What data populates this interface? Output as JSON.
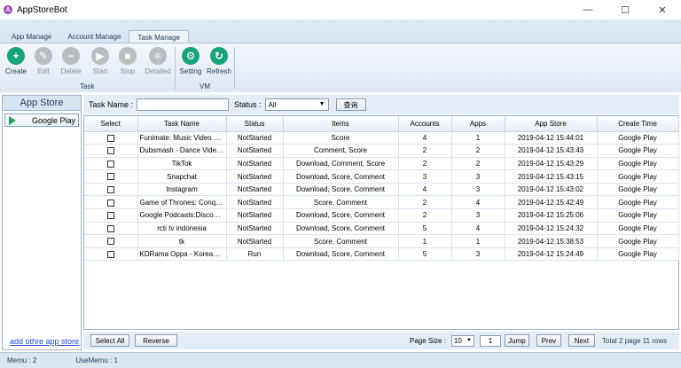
{
  "window": {
    "title": "AppStoreBot",
    "logo_letter": "A",
    "controls": [
      "—",
      "☐",
      "✕"
    ]
  },
  "ribbon": {
    "tabs": [
      {
        "label": "App Manage",
        "active": false
      },
      {
        "label": "Account Manage",
        "active": false
      },
      {
        "label": "Task Manage",
        "active": true
      }
    ],
    "task_group": "Task",
    "vm_group": "VM",
    "tools": {
      "create": "Create",
      "edit": "Edit",
      "delete": "Delete",
      "start": "Start",
      "stop": "Stop",
      "detailed": "Detailed",
      "setting": "Setting",
      "refresh": "Refresh"
    }
  },
  "left": {
    "header": "App Store",
    "store": "Google Play",
    "add_link": "add othre app store"
  },
  "filter": {
    "task_name_label": "Task Name :",
    "task_name_value": "",
    "status_label": "Status :",
    "status_value": "All",
    "query": "查询"
  },
  "table": {
    "columns": [
      "Select",
      "Task Name",
      "Status",
      "Items",
      "Accounts",
      "Apps",
      "App Store",
      "Create Time"
    ],
    "rows": [
      [
        "Funimate: Music Video Cli...",
        "NotStarted",
        "Score",
        "4",
        "1",
        "2019-04-12 15:44:01",
        "Google Play"
      ],
      [
        "Dubsmash - Dance Video...",
        "NotStarted",
        "Comment, Score",
        "2",
        "2",
        "2019-04-12 15:43:43",
        "Google Play"
      ],
      [
        "TikTok",
        "NotStarted",
        "Download, Comment, Score",
        "2",
        "2",
        "2019-04-12 15:43:29",
        "Google Play"
      ],
      [
        "Snapchat",
        "NotStarted",
        "Download, Score, Comment",
        "3",
        "3",
        "2019-04-12 15:43:15",
        "Google Play"
      ],
      [
        "Instagram",
        "NotStarted",
        "Download, Score, Comment",
        "4",
        "3",
        "2019-04-12 15:43:02",
        "Google Play"
      ],
      [
        "Game of Thrones: Conqu...",
        "NotStarted",
        "Score, Comment",
        "2",
        "4",
        "2019-04-12 15:42:49",
        "Google Play"
      ],
      [
        "Google Podcasts:Discover...",
        "NotStarted",
        "Download, Score, Comment",
        "2",
        "3",
        "2019-04-12 15:25:06",
        "Google Play"
      ],
      [
        "rcti tv indonesia",
        "NotStarted",
        "Download, Score, Comment",
        "5",
        "4",
        "2019-04-12 15:24:32",
        "Google Play"
      ],
      [
        "tk",
        "NotStarted",
        "Score, Comment",
        "1",
        "1",
        "2019-04-12 15:38:53",
        "Google Play"
      ],
      [
        "KDRama Oppa - Korean ...",
        "Run",
        "Download, Score, Comment",
        "5",
        "3",
        "2019-04-12 15:24:49",
        "Google Play"
      ]
    ]
  },
  "bottom": {
    "select_all": "Select All",
    "reverse": "Reverse",
    "page_size_label": "Page Size :",
    "page_size": "10",
    "page": "1",
    "jump": "Jump",
    "prev": "Prev",
    "next": "Next",
    "summary": "Total 2 page 11 rows"
  },
  "status": {
    "memu": "Memu :  2",
    "use_memu": "UseMemu :  1"
  },
  "colors": {
    "accent": "#1aa37a",
    "ribbon": "#dfe9f5",
    "link": "#1d4fd6"
  }
}
